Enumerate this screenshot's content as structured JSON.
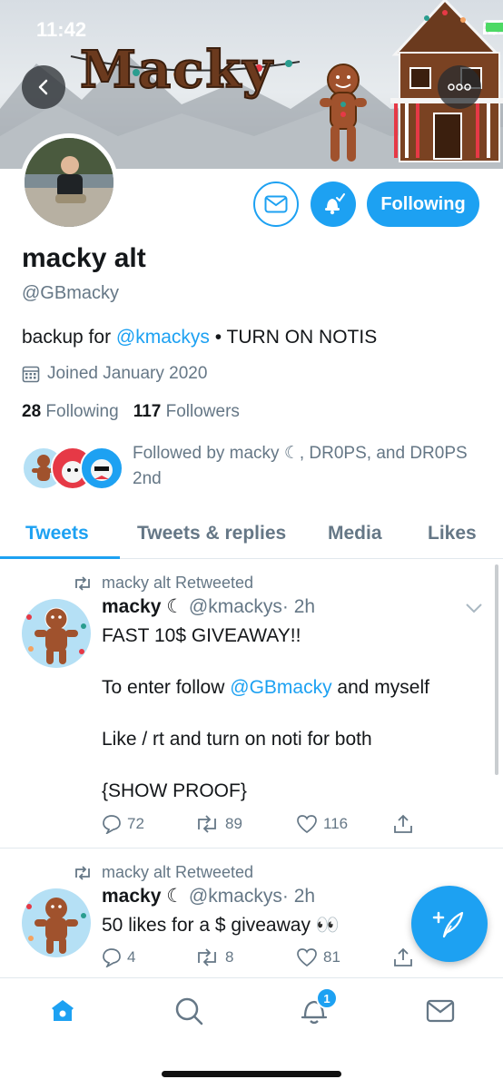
{
  "status_bar": {
    "time": "11:42"
  },
  "banner": {
    "text": "Macky"
  },
  "profile": {
    "name": "macky alt",
    "handle": "@GBmacky",
    "bio_prefix": "backup for ",
    "bio_mention": "@kmackys",
    "bio_suffix": " • TURN ON NOTIS",
    "joined": "Joined January 2020",
    "following_count": "28",
    "following_label": "Following",
    "followers_count": "117",
    "followers_label": "Followers",
    "followed_by": "Followed by macky ☾, DR0PS, and DR0PS 2nd",
    "follow_button": "Following"
  },
  "tabs": [
    {
      "label": "Tweets",
      "active": true
    },
    {
      "label": "Tweets & replies",
      "active": false
    },
    {
      "label": "Media",
      "active": false
    },
    {
      "label": "Likes",
      "active": false
    }
  ],
  "tweets": [
    {
      "retweeted_by": "macky alt Retweeted",
      "author_name": "macky",
      "author_handle": "@kmackys",
      "time": "· 2h",
      "line1": "FAST 10$ GIVEAWAY!!",
      "line2_prefix": "To enter follow ",
      "line2_mention": "@GBmacky",
      "line2_suffix": " and myself",
      "line3": "Like / rt and turn on noti for both",
      "line4": "{SHOW PROOF}",
      "replies": "72",
      "retweets": "89",
      "likes": "116"
    },
    {
      "retweeted_by": "macky alt Retweeted",
      "author_name": "macky",
      "author_handle": "@kmackys",
      "time": "· 2h",
      "line1": "50 likes for a $ giveaway 👀",
      "replies": "4",
      "retweets": "8",
      "likes": "81"
    }
  ],
  "bottom_nav": {
    "notification_badge": "1"
  },
  "colors": {
    "accent": "#1da1f2",
    "text": "#14171a",
    "secondary": "#657786"
  },
  "icons": [
    "back-arrow-icon",
    "more-icon",
    "mail-icon",
    "bell-check-icon",
    "calendar-icon",
    "retweet-icon",
    "reply-icon",
    "like-icon",
    "share-icon",
    "chevron-down-icon",
    "compose-icon",
    "home-icon",
    "search-icon",
    "notifications-icon",
    "messages-icon"
  ]
}
